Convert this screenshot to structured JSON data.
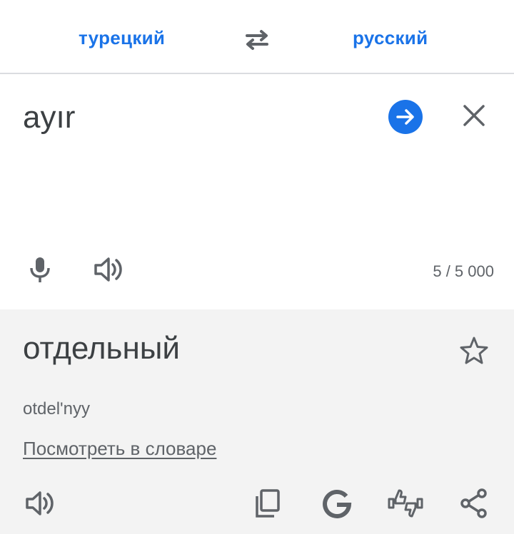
{
  "lang_bar": {
    "source_language": "турецкий",
    "target_language": "русский",
    "swap_icon": "swap-arrows-icon"
  },
  "input": {
    "text": "ayır",
    "char_count": "5 / 5 000",
    "icons": [
      "arrow-right-icon",
      "close-icon",
      "microphone-icon",
      "speaker-icon"
    ]
  },
  "result": {
    "translation": "отдельный",
    "transliteration": "otdel'nyy",
    "dictionary_link": "Посмотреть в словаре",
    "icons": [
      "star-icon",
      "speaker-icon",
      "copy-icon",
      "google-icon",
      "feedback-icon",
      "share-icon"
    ]
  },
  "colors": {
    "accent": "#1a73e8",
    "text": "#3c4043",
    "secondary_text": "#5f6368",
    "result_background": "#f3f3f3",
    "divider": "#dadce0"
  }
}
